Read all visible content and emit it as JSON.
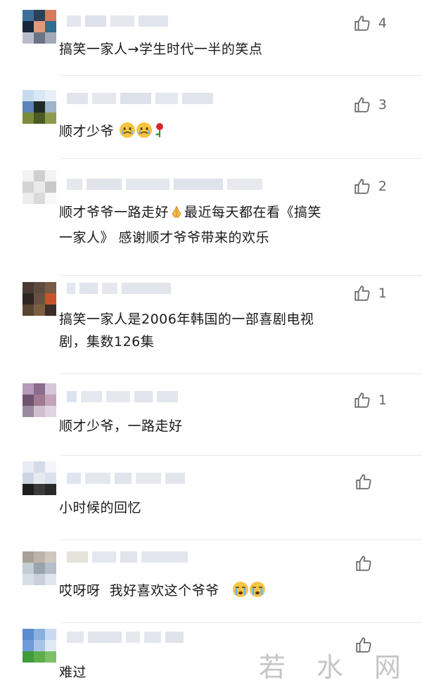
{
  "comments": [
    {
      "likes": "4",
      "text": "搞笑一家人→学生时代一半的笑点"
    },
    {
      "likes": "3",
      "text": "顺才少爷"
    },
    {
      "likes": "2",
      "text_line1": "顺才爷爷一路走好",
      "text_line1b": "最近每天都在看《搞笑",
      "text_line2": "一家人》 感谢顺才爷爷带来的欢乐"
    },
    {
      "likes": "1",
      "text_line1": "搞笑一家人是2006年韩国的一部喜剧电视",
      "text_line2": "剧，集数126集"
    },
    {
      "likes": "1",
      "text": "顺才少爷，一路走好"
    },
    {
      "likes": "",
      "text": "小时候的回忆"
    },
    {
      "likes": "",
      "text": "哎呀呀  我好喜欢这个爷爷"
    },
    {
      "likes": "",
      "text": "难过"
    }
  ],
  "icons": {
    "like": "thumbs-up-icon",
    "emoji_cry": "crying-face-icon",
    "emoji_rose": "rose-icon",
    "emoji_pray": "praying-hands-icon"
  },
  "watermark": "若 水 网"
}
